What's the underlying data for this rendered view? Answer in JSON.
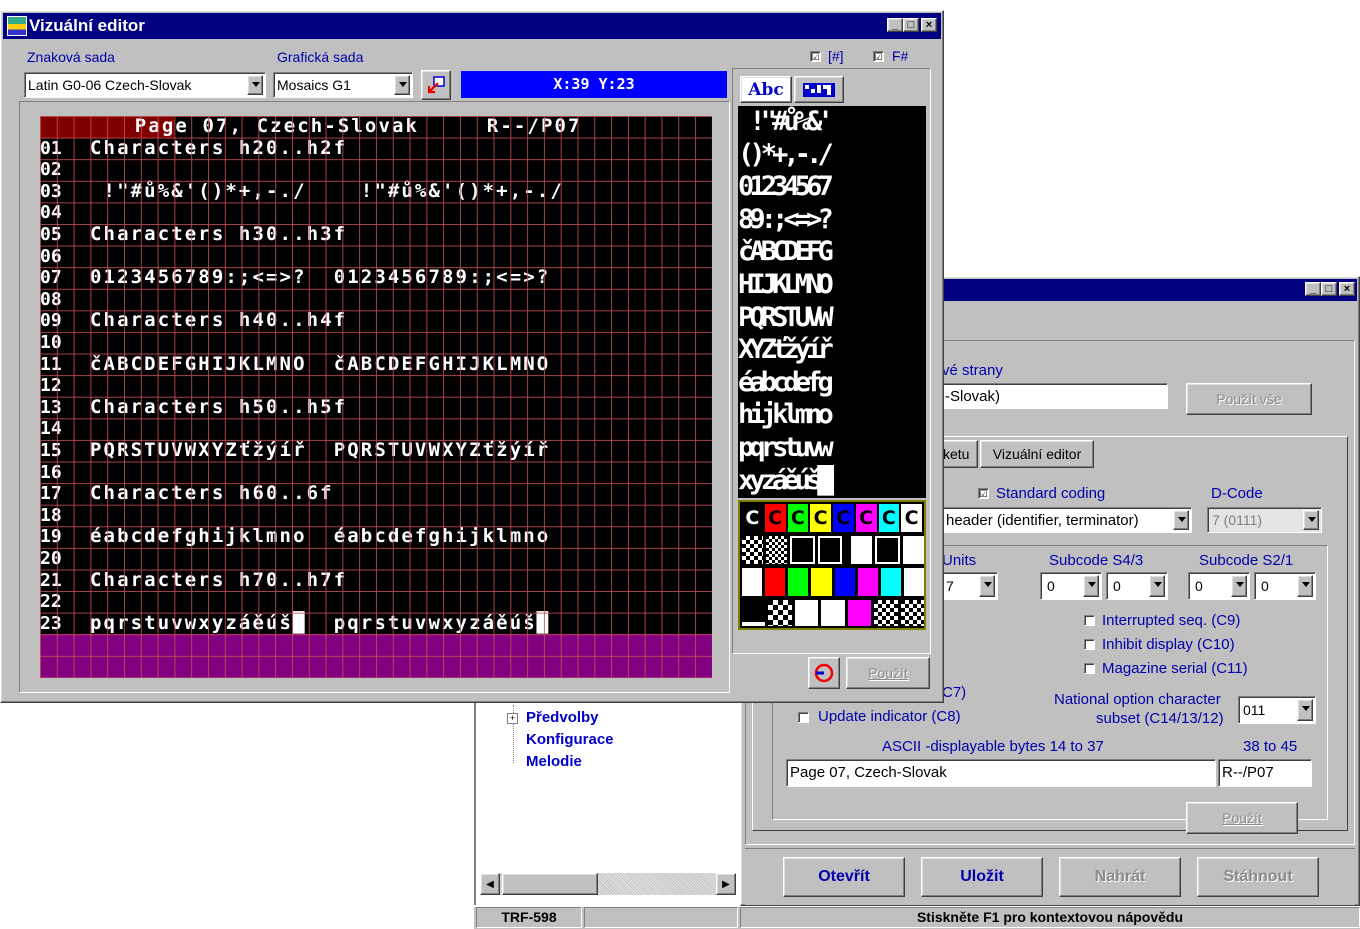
{
  "editor": {
    "title": "Vizuální editor",
    "char_set_label": "Znaková sada",
    "graphic_set_label": "Grafická sada",
    "char_set_value": "Latin G0-06 Czech-Slovak",
    "graphic_set_value": "Mosaics G1",
    "check1_label": "[#]",
    "check2_label": "F#",
    "check_mark": "☑",
    "coords": "X:39 Y:23",
    "palette_tab_text": "Abc",
    "palette_apply": "Použít",
    "rows": [
      {
        "num": "",
        "text": "       Page 07, Czech-Slovak     R--/P07"
      },
      {
        "num": "01",
        "text": "Characters h20..h2f"
      },
      {
        "num": "02",
        "text": ""
      },
      {
        "num": "03",
        "text": " !\"#ů%&'()*+,-./    !\"#ů%&'()*+,-./"
      },
      {
        "num": "04",
        "text": ""
      },
      {
        "num": "05",
        "text": "Characters h30..h3f"
      },
      {
        "num": "06",
        "text": ""
      },
      {
        "num": "07",
        "text": "0123456789:;<=>?  0123456789:;<=>?"
      },
      {
        "num": "08",
        "text": ""
      },
      {
        "num": "09",
        "text": "Characters h40..h4f"
      },
      {
        "num": "10",
        "text": ""
      },
      {
        "num": "11",
        "text": "čABCDEFGHIJKLMNO  čABCDEFGHIJKLMNO"
      },
      {
        "num": "12",
        "text": ""
      },
      {
        "num": "13",
        "text": "Characters h50..h5f"
      },
      {
        "num": "14",
        "text": ""
      },
      {
        "num": "15",
        "text": "PQRSTUVWXYZťžýíř  PQRSTUVWXYZťžýíř"
      },
      {
        "num": "16",
        "text": ""
      },
      {
        "num": "17",
        "text": "Characters h60..6f"
      },
      {
        "num": "18",
        "text": ""
      },
      {
        "num": "19",
        "text": "éabcdefghijklmno  éabcdefghijklmno"
      },
      {
        "num": "20",
        "text": ""
      },
      {
        "num": "21",
        "text": "Characters h70..h7f"
      },
      {
        "num": "22",
        "text": ""
      },
      {
        "num": "23",
        "text": "pqrstuvwxyzáěúš█  pqrstuvwxyzáěúš█"
      }
    ],
    "palette_chars": [
      " !\"#ů%&'",
      "()*+,-./",
      "01234567",
      "89:;<=>?",
      "čABCDEFG",
      "HIJKLMNO",
      "PQRSTUVW",
      "XYZťžýíř",
      "éabcdefg",
      "hijklmno",
      "pqrstuvw",
      "xyzáěúš█"
    ],
    "palette_colors": [
      "#ffffff",
      "#ff0000",
      "#00ff00",
      "#ffff00",
      "#0000ff",
      "#ff00ff",
      "#00ffff",
      "#ffffff"
    ]
  },
  "main": {
    "strany_label": "vé strany",
    "slovak_value": "-Slovak)",
    "apply_all": "Použít vše",
    "tab_ketu": "ketu",
    "tab_visual": "Vizuální editor",
    "standard_coding": "Standard coding",
    "dcode_label": "D-Code",
    "dcode_value": "7 (0111)",
    "header_value": "header (identifier, terminator)",
    "units_label": "Units",
    "units_value": "7",
    "s43_label": "Subcode S4/3",
    "s21_label": "Subcode S2/1",
    "s43_a": "0",
    "s43_b": "0",
    "s21_a": "0",
    "s21_b": "0",
    "interrupted": "Interrupted seq. (C9)",
    "inhibit": "Inhibit display (C10)",
    "magazine": "Magazine serial (C11)",
    "c7_label": "C7)",
    "update_indicator": "Update indicator (C8)",
    "national_label_1": "National option character",
    "national_label_2": "subset (C14/13/12)",
    "national_value": "011",
    "ascii_label": "ASCII -displayable bytes 14 to 37",
    "range_label": "38 to 45",
    "ascii_value": "Page 07, Czech-Slovak",
    "range_value": "R--/P07",
    "apply": "Použít",
    "open": "Otevřít",
    "save": "Uložit",
    "upload": "Nahrát",
    "download": "Stáhnout"
  },
  "tree": {
    "items": [
      "Předvolby",
      "Konfigurace",
      "Melodie"
    ],
    "expander": "+"
  },
  "statusbar": {
    "device": "TRF-598",
    "help": "Stiskněte F1 pro kontextovou nápovědu"
  },
  "window_buttons": {
    "minimize": "_",
    "maximize": "□",
    "close": "×"
  },
  "colors": {
    "titlebar": "#000080",
    "teletext_bg": "#000000",
    "grid": "#c05050",
    "header_row": "#800000",
    "bottom_row": "#800080",
    "coords_bg": "#0000ff"
  }
}
